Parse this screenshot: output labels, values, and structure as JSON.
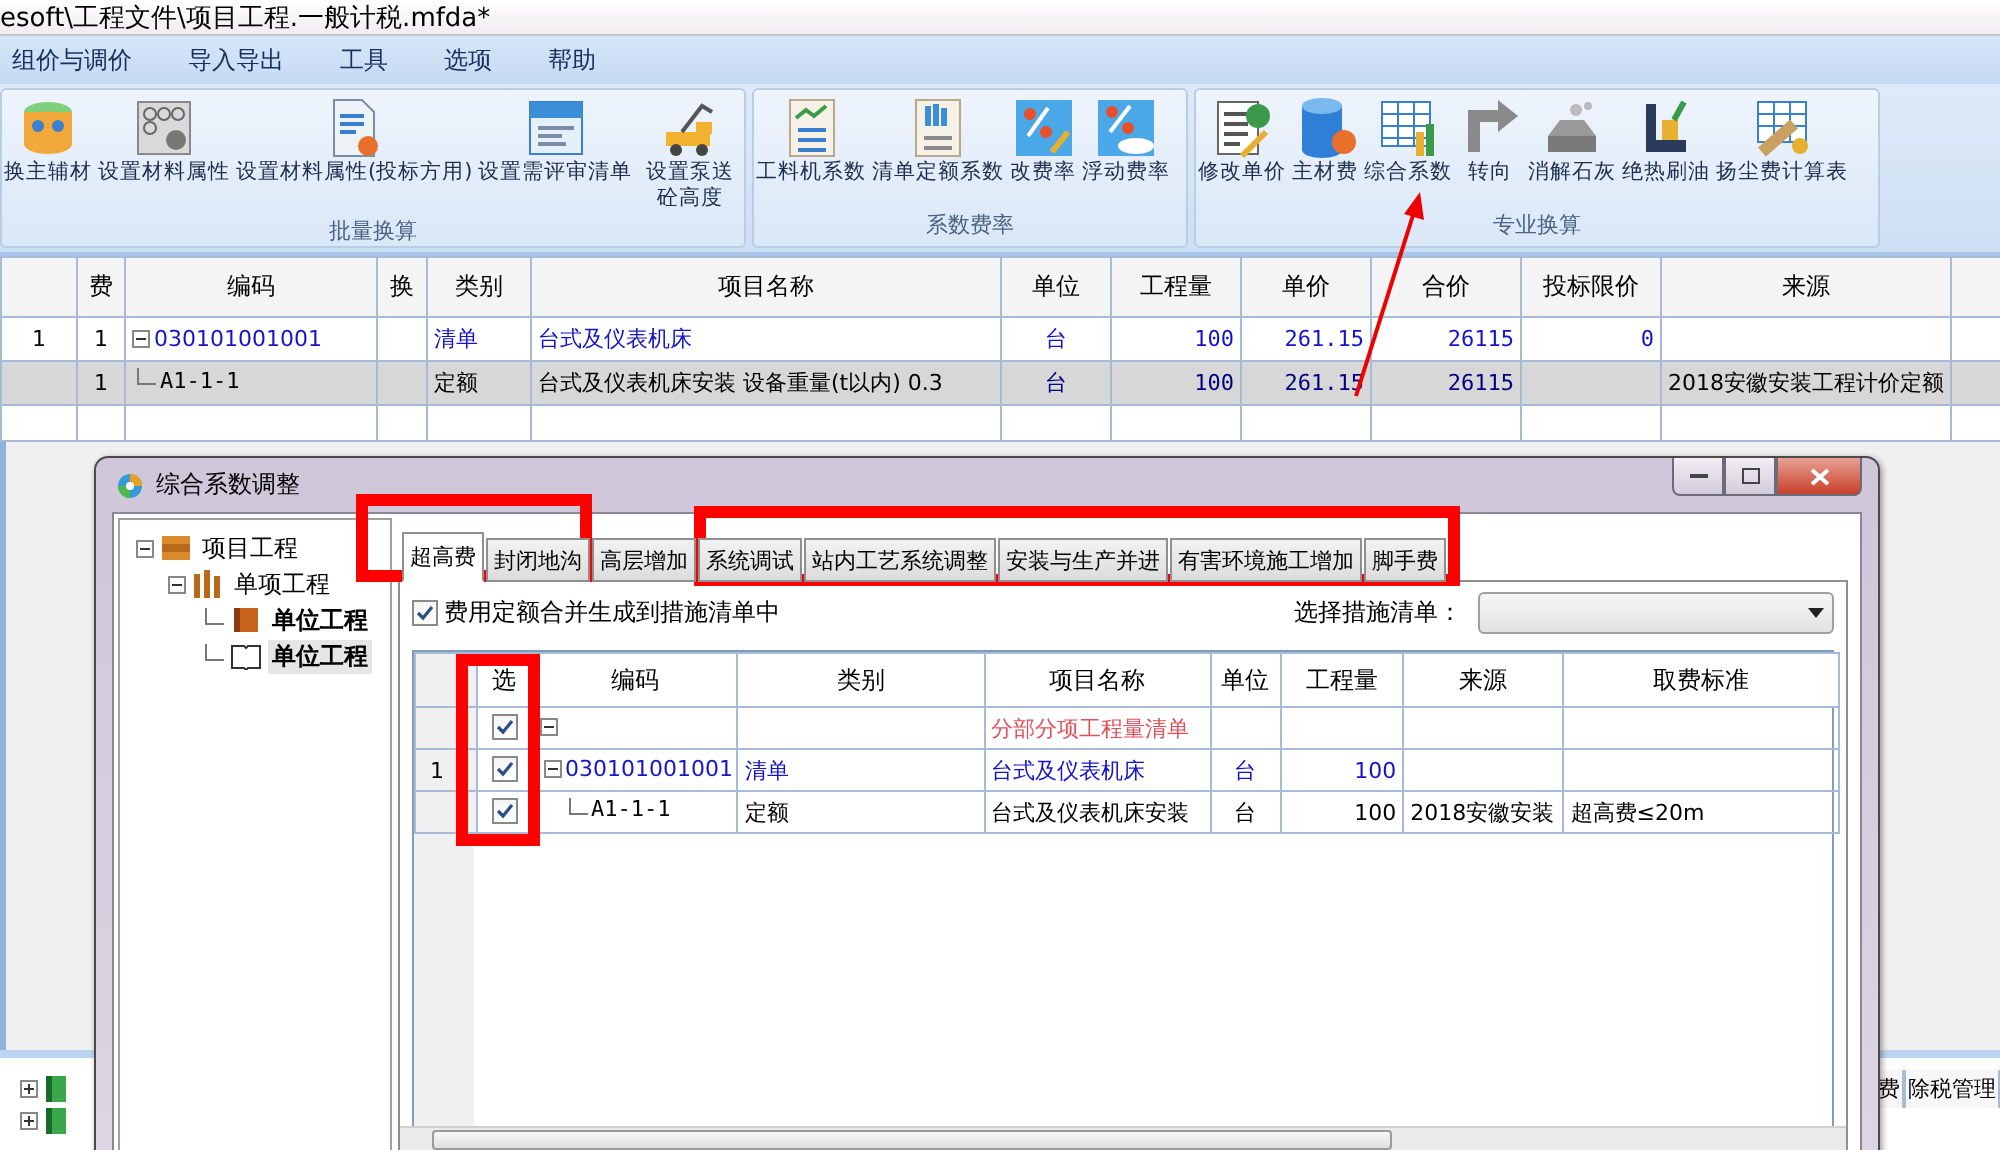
{
  "window": {
    "title": "esoft\\工程文件\\项目工程.一般计税.mfda*"
  },
  "menu": [
    "组价与调价",
    "导入导出",
    "工具",
    "选项",
    "帮助"
  ],
  "ribbon": [
    {
      "label": "批量换算",
      "buttons": [
        "换主辅材",
        "设置材料属性",
        "设置材料属性(投标方用)",
        "设置需评审清单",
        "设置泵送砼高度"
      ]
    },
    {
      "label": "系数费率",
      "buttons": [
        "工料机系数",
        "清单定额系数",
        "改费率",
        "浮动费率"
      ]
    },
    {
      "label": "专业换算",
      "buttons": [
        "修改单价",
        "主材费",
        "综合系数",
        "转向",
        "消解石灰",
        "绝热刷油",
        "扬尘费计算表"
      ]
    }
  ],
  "main_table": {
    "columns": [
      "费",
      "编码",
      "换",
      "类别",
      "项目名称",
      "单位",
      "工程量",
      "单价",
      "合价",
      "投标限价",
      "来源"
    ],
    "rows": [
      {
        "kind": "bill",
        "selected": false,
        "expanded": true,
        "number": "1",
        "fee": "1",
        "code": "030101001001",
        "category": "清单",
        "name": "台式及仪表机床",
        "unit": "台",
        "quantity": "100",
        "unit_price": "261.15",
        "total": "26115",
        "limit": "0"
      },
      {
        "kind": "quota",
        "selected": true,
        "fee": "1",
        "code": "A1-1-1",
        "category": "定额",
        "name": "台式及仪表机床安装 设备重量(t以内) 0.3",
        "unit": "台",
        "quantity": "100",
        "unit_price": "261.15",
        "total": "26115",
        "source": "2018安徽安装工程计价定额"
      }
    ]
  },
  "bottom_panel": {
    "tree": [
      {
        "expanded": false
      },
      {
        "expanded": false
      }
    ],
    "columns": [
      "费",
      "除税管理"
    ]
  },
  "dialog": {
    "title": "综合系数调整",
    "tree": [
      {
        "label": "项目工程",
        "expanded": true,
        "selected": false,
        "children": [
          {
            "label": "单项工程",
            "expanded": true,
            "selected": false,
            "children": [
              {
                "label": "单位工程",
                "selected": false
              },
              {
                "label": "单位工程",
                "selected": true
              }
            ]
          }
        ]
      }
    ],
    "tabs": [
      {
        "label": "超高费",
        "selected": true
      },
      {
        "label": "封闭地沟",
        "selected": false
      },
      {
        "label": "高层增加",
        "selected": false
      },
      {
        "label": "系统调试",
        "selected": false
      },
      {
        "label": "站内工艺系统调整",
        "selected": false
      },
      {
        "label": "安装与生产并进",
        "selected": false
      },
      {
        "label": "有害环境施工增加",
        "selected": false
      },
      {
        "label": "脚手费",
        "selected": false
      }
    ],
    "merge_option": {
      "label": "费用定额合并生成到措施清单中",
      "checked": true
    },
    "measure_select": {
      "label": "选择措施清单："
    },
    "table": {
      "columns": [
        "选",
        "编码",
        "类别",
        "项目名称",
        "单位",
        "工程量",
        "来源",
        "取费标准"
      ],
      "rows": [
        {
          "kind": "section",
          "checked": true,
          "expanded": true,
          "name": "分部分项工程量清单"
        },
        {
          "kind": "bill",
          "checked": true,
          "expanded": true,
          "number": "1",
          "code": "030101001001",
          "category": "清单",
          "name": "台式及仪表机床",
          "unit": "台",
          "quantity": "100"
        },
        {
          "kind": "quota",
          "checked": true,
          "code": "A1-1-1",
          "category": "定额",
          "name": "台式及仪表机床安装",
          "unit": "台",
          "quantity": "100",
          "source": "2018安徽安装",
          "fee_standard": "超高费≤20m"
        }
      ]
    }
  }
}
